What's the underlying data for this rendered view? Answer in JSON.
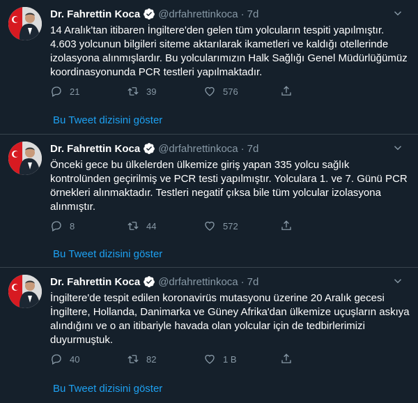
{
  "tweets": [
    {
      "name": "Dr. Fahrettin Koca",
      "handle": "@drfahrettinkoca",
      "separator": "·",
      "time": "7d",
      "text": "14 Aralık'tan itibaren İngiltere'den gelen tüm yolcuların tespiti yapılmıştır.\n4.603 yolcunun bilgileri siteme aktarılarak ikametleri ve kaldığı otellerinde\nizolasyona alınmışlardır. Bu yolcularımızın Halk Sağlığı Genel Müdürlüğümüz\nkoordinasyonunda PCR testleri yapılmaktadır.",
      "replies": "21",
      "retweets": "39",
      "likes": "576",
      "show_thread": "Bu Tweet dizisini göster"
    },
    {
      "name": "Dr. Fahrettin Koca",
      "handle": "@drfahrettinkoca",
      "separator": "·",
      "time": "7d",
      "text": "Önceki gece bu ülkelerden ülkemize giriş yapan 335 yolcu sağlık\nkontrolünden geçirilmiş ve PCR testi yapılmıştır. Yolculara 1. ve 7. Günü PCR\nörnekleri alınmaktadır. Testleri negatif çıksa bile tüm yolcular izolasyona\nalınmıştır.",
      "replies": "8",
      "retweets": "44",
      "likes": "572",
      "show_thread": "Bu Tweet dizisini göster"
    },
    {
      "name": "Dr. Fahrettin Koca",
      "handle": "@drfahrettinkoca",
      "separator": "·",
      "time": "7d",
      "text": "İngiltere'de tespit edilen koronavirüs mutasyonu üzerine 20 Aralık gecesi\nİngiltere, Hollanda, Danimarka ve Güney Afrika'dan ülkemize uçuşların askıya\nalındığını ve o an itibariyle havada olan yolcular için de tedbirlerimizi\nduyurmuştuk.",
      "replies": "40",
      "retweets": "82",
      "likes": "1 B",
      "show_thread": "Bu Tweet dizisini göster"
    }
  ],
  "colors": {
    "background": "#15202b",
    "divider": "#38444d",
    "secondary_text": "#8899a6",
    "link": "#1da1f2",
    "verified": "#ffffff"
  }
}
